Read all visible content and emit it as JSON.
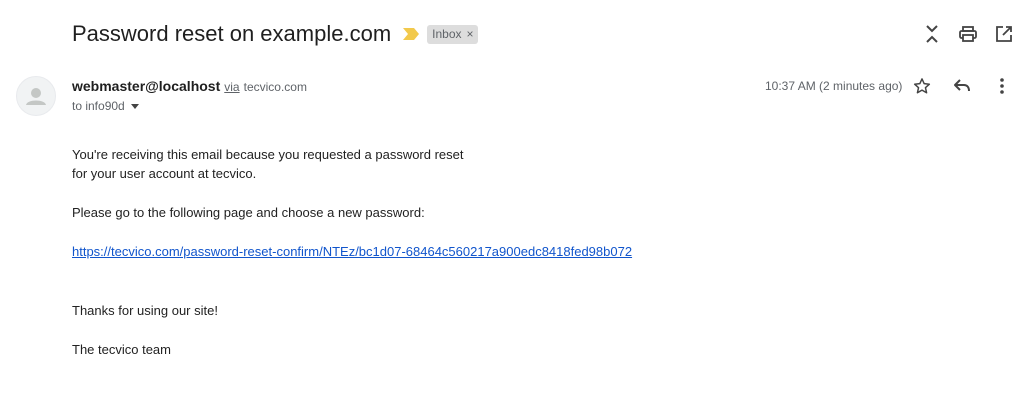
{
  "email": {
    "subject": "Password reset on example.com",
    "label": "Inbox",
    "label_close": "×",
    "sender": {
      "name": "webmaster@localhost",
      "via_label": "via",
      "via_domain": "tecvico.com"
    },
    "to_text": "to info90d",
    "timestamp": "10:37 AM (2 minutes ago)",
    "body": {
      "line1": "You're receiving this email because you requested a password reset",
      "line2": "for your user account at tecvico.",
      "line3": "Please go to the following page and choose a new password:",
      "link": "https://tecvico.com/password-reset-confirm/NTEz/bc1d07-68464c560217a900edc8418fed98b072",
      "thanks": "Thanks for using our site!",
      "signature": "The tecvico team"
    }
  },
  "icons": {
    "top_actions": [
      "collapse-icon",
      "print-icon",
      "open-in-new-window-icon"
    ],
    "message_actions": [
      "star-icon",
      "reply-icon",
      "more-vert-icon"
    ],
    "importance": "importance-marker-icon",
    "avatar": "default-avatar-icon"
  },
  "colors": {
    "importance": "#f2c94c",
    "link": "#1155cc",
    "label_chip_bg": "#dddddd"
  }
}
